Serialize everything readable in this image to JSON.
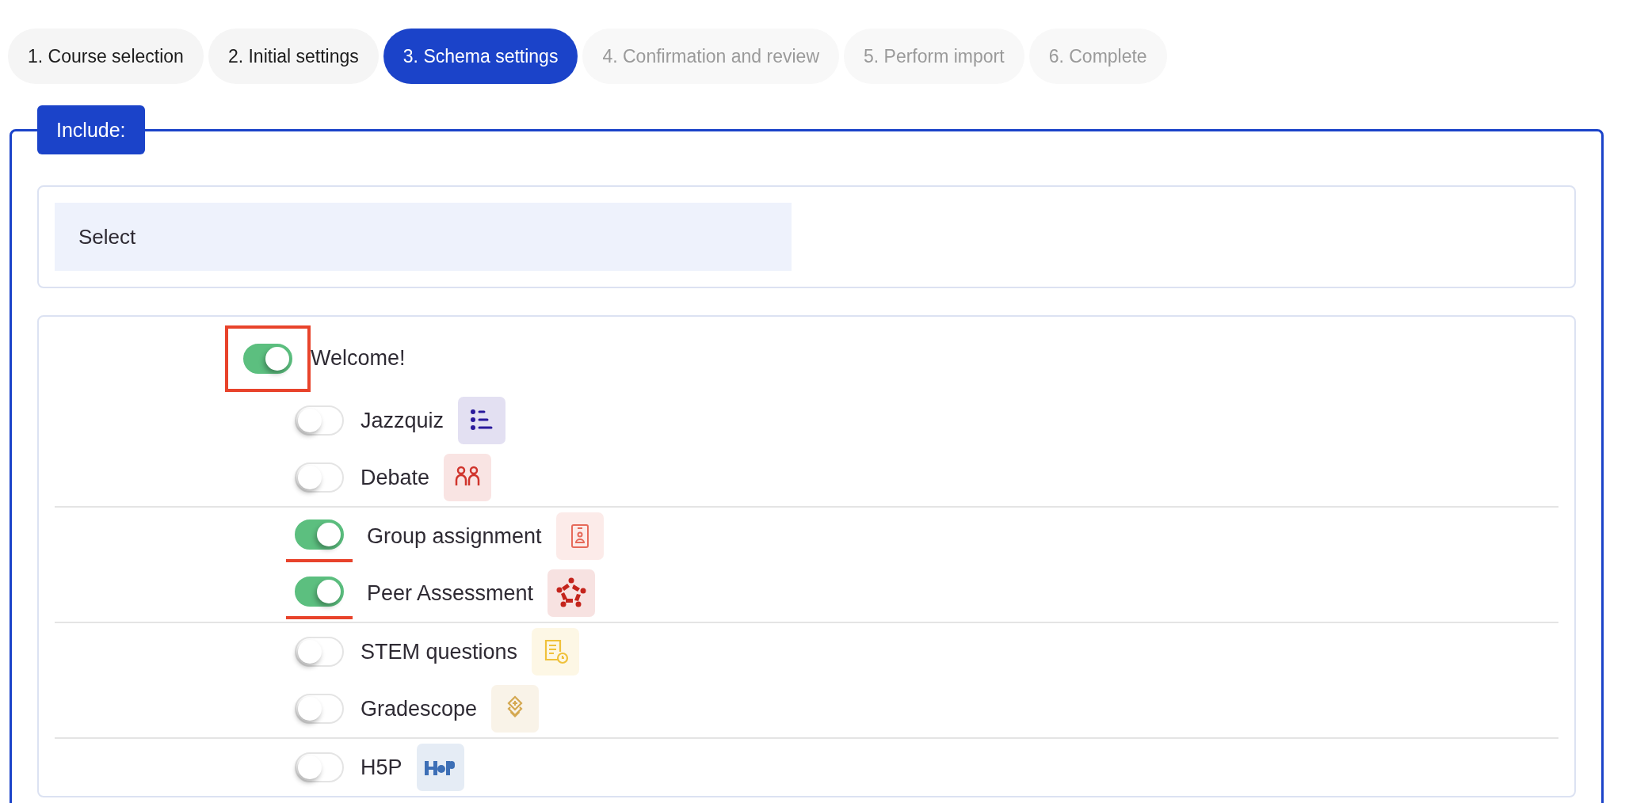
{
  "tabs": [
    {
      "label": "1. Course selection",
      "selected": false,
      "disabled": false
    },
    {
      "label": "2. Initial settings",
      "selected": false,
      "disabled": false
    },
    {
      "label": "3. Schema settings",
      "selected": true,
      "disabled": false
    },
    {
      "label": "4. Confirmation and review",
      "selected": false,
      "disabled": true
    },
    {
      "label": "5. Perform import",
      "selected": false,
      "disabled": true
    },
    {
      "label": "6. Complete",
      "selected": false,
      "disabled": true
    }
  ],
  "include": {
    "legend": "Include:",
    "select": {
      "label": "Select"
    },
    "tree": {
      "label": "Welcome!",
      "on": true,
      "boxed": true,
      "sections": [
        {
          "children": [
            {
              "label": "Jazzquiz",
              "on": false,
              "underlined": false,
              "kind": "list",
              "color": "#2a1a9c"
            },
            {
              "label": "Debate",
              "on": false,
              "underlined": false,
              "kind": "people",
              "color": "#d0342c"
            }
          ]
        },
        {
          "children": [
            {
              "label": "Group assignment",
              "on": true,
              "underlined": true,
              "kind": "badge",
              "color": "#e66a5a"
            },
            {
              "label": "Peer Assessment",
              "on": true,
              "underlined": true,
              "kind": "circle-people",
              "color": "#c4241c"
            }
          ]
        },
        {
          "children": [
            {
              "label": "STEM questions",
              "on": false,
              "underlined": false,
              "kind": "doc-clock",
              "color": "#efc13a"
            },
            {
              "label": "Gradescope",
              "on": false,
              "underlined": false,
              "kind": "diamonds",
              "color": "#d4a850"
            }
          ]
        },
        {
          "children": [
            {
              "label": "H5P",
              "on": false,
              "underlined": false,
              "kind": "blocks",
              "color": "#3d6fb6"
            }
          ]
        }
      ]
    }
  }
}
